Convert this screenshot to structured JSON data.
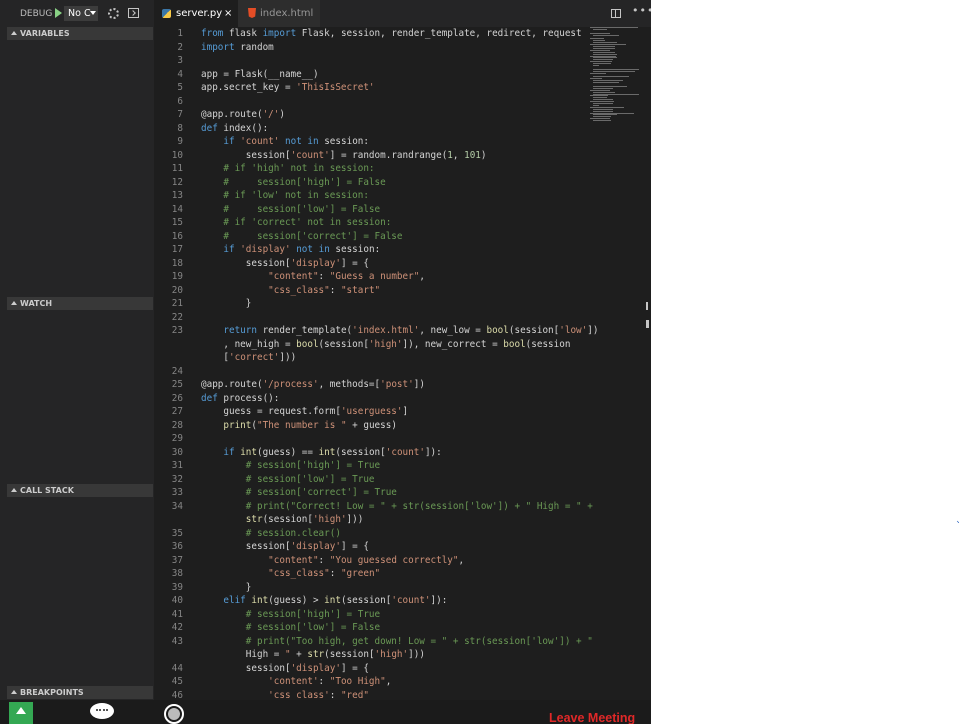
{
  "debug": {
    "label": "DEBUG",
    "config_value": "No C"
  },
  "tabs": [
    {
      "label": "server.py",
      "close": "×"
    },
    {
      "label": "index.html"
    }
  ],
  "sidebar": {
    "sections": [
      "VARIABLES",
      "WATCH",
      "CALL STACK",
      "BREAKPOINTS"
    ]
  },
  "icons": {
    "play": "play-icon",
    "gear": "gear-icon",
    "console": "console-icon",
    "python": "python-file-icon",
    "html": "html-file-icon",
    "split": "split-editor-icon",
    "more": "more-actions-icon",
    "share": "share-screen-icon",
    "chat": "chat-icon",
    "record": "record-icon"
  },
  "colors": {
    "keyword": "#569cd6",
    "string": "#ce9178",
    "comment": "#6a9955",
    "leave": "#e02828"
  },
  "code_lines": [
    {
      "n": "1",
      "text": "from flask import Flask, session, render_template, redirect, request"
    },
    {
      "n": "2",
      "text": "import random"
    },
    {
      "n": "3",
      "text": ""
    },
    {
      "n": "4",
      "text": "app = Flask(__name__)"
    },
    {
      "n": "5",
      "text": "app.secret_key = 'ThisIsSecret'"
    },
    {
      "n": "6",
      "text": ""
    },
    {
      "n": "7",
      "text": "@app.route('/')"
    },
    {
      "n": "8",
      "text": "def index():"
    },
    {
      "n": "9",
      "text": "    if 'count' not in session:"
    },
    {
      "n": "10",
      "text": "        session['count'] = random.randrange(1, 101)"
    },
    {
      "n": "11",
      "text": "    # if 'high' not in session:"
    },
    {
      "n": "12",
      "text": "    #     session['high'] = False"
    },
    {
      "n": "13",
      "text": "    # if 'low' not in session:"
    },
    {
      "n": "14",
      "text": "    #     session['low'] = False"
    },
    {
      "n": "15",
      "text": "    # if 'correct' not in session:"
    },
    {
      "n": "16",
      "text": "    #     session['correct'] = False"
    },
    {
      "n": "17",
      "text": "    if 'display' not in session:"
    },
    {
      "n": "18",
      "text": "        session['display'] = {"
    },
    {
      "n": "19",
      "text": "            \"content\": \"Guess a number\","
    },
    {
      "n": "20",
      "text": "            \"css_class\": \"start\""
    },
    {
      "n": "21",
      "text": "        }"
    },
    {
      "n": "22",
      "text": "    "
    },
    {
      "n": "23",
      "text": "    return render_template('index.html', new_low = bool(session['low'])"
    },
    {
      "n": "",
      "text": "    , new_high = bool(session['high']), new_correct = bool(session"
    },
    {
      "n": "",
      "text": "    ['correct']))"
    },
    {
      "n": "24",
      "text": ""
    },
    {
      "n": "25",
      "text": "@app.route('/process', methods=['post'])"
    },
    {
      "n": "26",
      "text": "def process():"
    },
    {
      "n": "27",
      "text": "    guess = request.form['userguess']"
    },
    {
      "n": "28",
      "text": "    print(\"The number is \" + guess)"
    },
    {
      "n": "29",
      "text": ""
    },
    {
      "n": "30",
      "text": "    if int(guess) == int(session['count']):"
    },
    {
      "n": "31",
      "text": "        # session['high'] = True"
    },
    {
      "n": "32",
      "text": "        # session['low'] = True"
    },
    {
      "n": "33",
      "text": "        # session['correct'] = True"
    },
    {
      "n": "34",
      "text": "        # print(\"Correct! Low = \" + str(session['low']) + \" High = \" +"
    },
    {
      "n": "",
      "text": "        str(session['high']))"
    },
    {
      "n": "35",
      "text": "        # session.clear()"
    },
    {
      "n": "36",
      "text": "        session['display'] = {"
    },
    {
      "n": "37",
      "text": "            \"content\": \"You guessed correctly\","
    },
    {
      "n": "38",
      "text": "            \"css_class\": \"green\""
    },
    {
      "n": "39",
      "text": "        }"
    },
    {
      "n": "40",
      "text": "    elif int(guess) > int(session['count']):"
    },
    {
      "n": "41",
      "text": "        # session['high'] = True"
    },
    {
      "n": "42",
      "text": "        # session['low'] = False"
    },
    {
      "n": "43",
      "text": "        # print(\"Too high, get down! Low = \" + str(session['low']) + \""
    },
    {
      "n": "",
      "text": "        High = \" + str(session['high']))"
    },
    {
      "n": "44",
      "text": "        session['display'] = {"
    },
    {
      "n": "45",
      "text": "            'content': \"Too High\","
    },
    {
      "n": "46",
      "text": "            'css_class': \"red\""
    }
  ],
  "bottom": {
    "leave_label": "Leave Meeting"
  }
}
